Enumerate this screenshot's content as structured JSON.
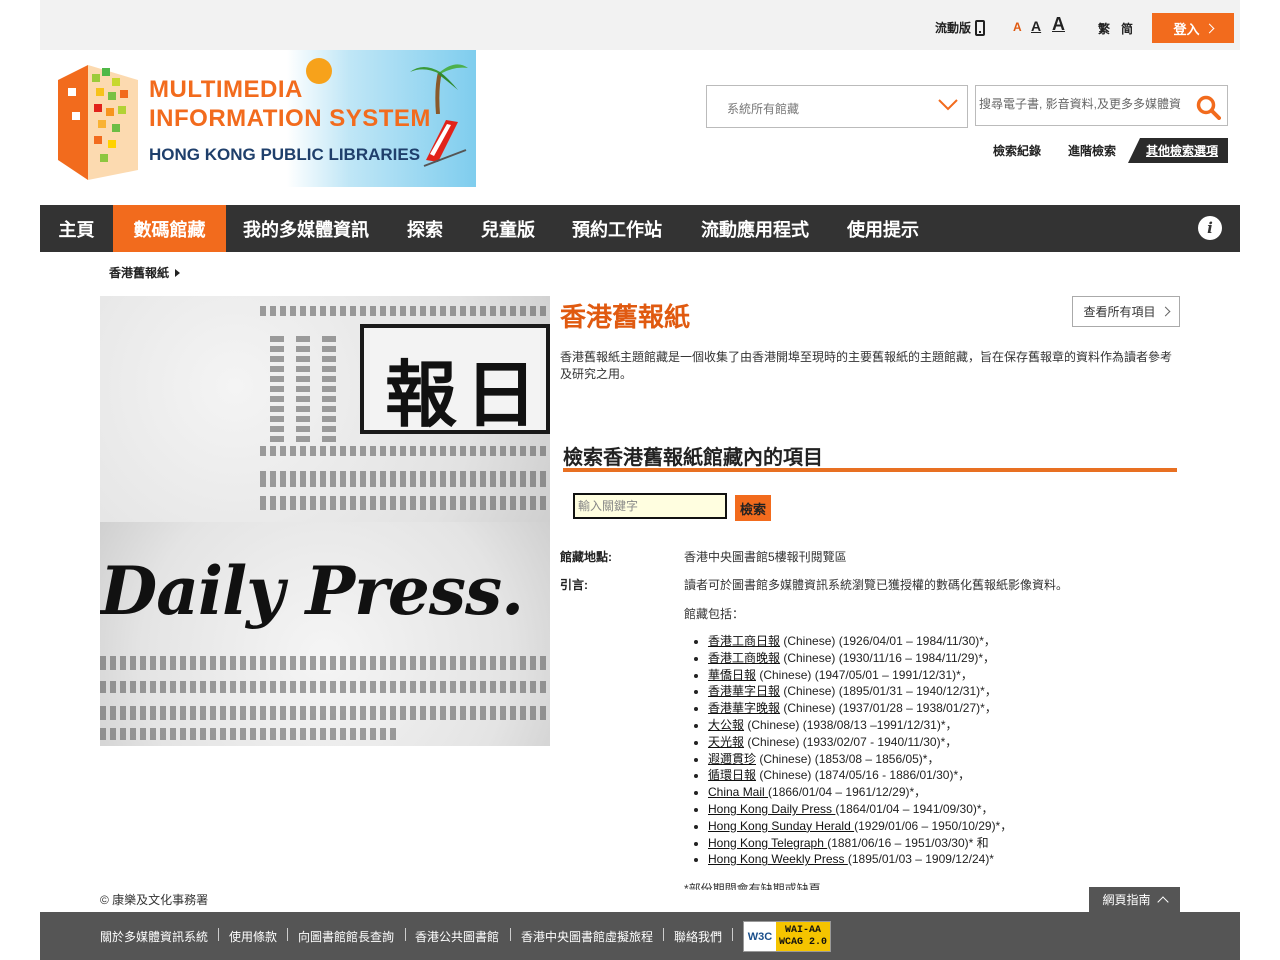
{
  "topbar": {
    "mobile_label": "流動版",
    "font_small": "A",
    "font_medium": "A",
    "font_large": "A",
    "lang_traditional": "繁",
    "lang_simplified": "简",
    "login_label": "登入"
  },
  "logo": {
    "line1": "MULTIMEDIA",
    "line2": "INFORMATION SYSTEM",
    "line3": "HONG KONG PUBLIC LIBRARIES"
  },
  "search": {
    "scope_label": "系統所有館藏",
    "placeholder": "搜尋電子書, 影音資料,及更多多媒體資",
    "history_link": "檢索紀錄",
    "advanced_link": "進階檢索",
    "more_options": "其他檢索選項"
  },
  "nav": {
    "items": [
      "主頁",
      "數碼館藏",
      "我的多媒體資訊",
      "探索",
      "兒童版",
      "預約工作站",
      "流動應用程式",
      "使用提示"
    ],
    "info_label": "i"
  },
  "breadcrumb": {
    "current": "香港舊報紙"
  },
  "hero": {
    "masthead_text": "報日",
    "english_text": "Daily Press."
  },
  "content": {
    "title": "香港舊報紙",
    "view_all": "查看所有項目",
    "description": "香港舊報紙主題館藏是一個收集了由香港開埠至現時的主要舊報紙的主題館藏，旨在保存舊報章的資料作為讀者參考及研究之用。",
    "search_heading": "檢索香港舊報紙館藏內的項目",
    "keyword_placeholder": "輸入關鍵字",
    "search_button": "檢索",
    "location_label": "館藏地點:",
    "location_value": "香港中央圖書館5樓報刊閱覽區",
    "intro_label": "引言:",
    "intro_value": "讀者可於圖書館多媒體資訊系統瀏覽已獲授權的數碼化舊報紙影像資料。",
    "includes_label": "館藏包括：",
    "items": [
      {
        "name": "香港工商日報",
        "detail": " (Chinese) (1926/04/01 – 1984/11/30)*，"
      },
      {
        "name": "香港工商晚報",
        "detail": " (Chinese) (1930/11/16 – 1984/11/29)*，"
      },
      {
        "name": "華僑日報",
        "detail": " (Chinese) (1947/05/01 – 1991/12/31)*，"
      },
      {
        "name": "香港華字日報",
        "detail": " (Chinese) (1895/01/31 – 1940/12/31)*，"
      },
      {
        "name": "香港華字晚報",
        "detail": " (Chinese) (1937/01/28 – 1938/01/27)*，"
      },
      {
        "name": "大公報",
        "detail": " (Chinese) (1938/08/13 –1991/12/31)*，"
      },
      {
        "name": "天光報",
        "detail": " (Chinese) (1933/02/07 - 1940/11/30)*，"
      },
      {
        "name": "遐邇貫珍",
        "detail": " (Chinese) (1853/08 – 1856/05)*，"
      },
      {
        "name": "循環日報",
        "detail": " (Chinese) (1874/05/16 - 1886/01/30)*，"
      },
      {
        "name": "China Mail ",
        "detail": "(1866/01/04 – 1961/12/29)*，"
      },
      {
        "name": "Hong Kong Daily Press ",
        "detail": "(1864/01/04 – 1941/09/30)*，"
      },
      {
        "name": "Hong Kong Sunday Herald ",
        "detail": "(1929/01/06 – 1950/10/29)*，"
      },
      {
        "name": "Hong Kong Telegraph ",
        "detail": "(1881/06/16 – 1951/03/30)* 和"
      },
      {
        "name": "Hong Kong Weekly Press ",
        "detail": "(1895/01/03 – 1909/12/24)*"
      }
    ],
    "footnote": "*部份期間會有缺期或缺頁"
  },
  "footer": {
    "copyright": "© 康樂及文化事務署",
    "sitemap": "網頁指南",
    "links": [
      "關於多媒體資訊系統",
      "使用條款",
      "向圖書館館長查詢",
      "香港公共圖書館",
      "香港中央圖書館虛擬旅程",
      "聯絡我們"
    ],
    "w3c": "W3C",
    "wcag_line1": "WAI-AA",
    "wcag_line2": "WCAG 2.0"
  },
  "colors": {
    "accent": "#f26b1d",
    "nav_bg": "#333333",
    "footer_bg": "#555555"
  }
}
